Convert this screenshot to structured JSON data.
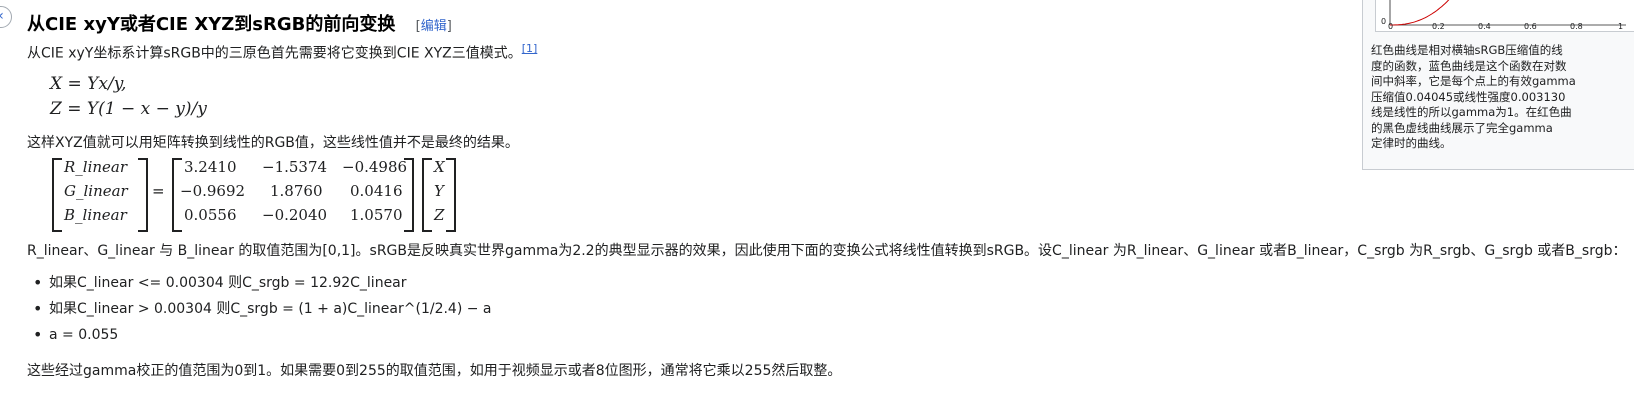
{
  "heading": {
    "title": "从CIE xyY或者CIE XYZ到sRGB的前向变换",
    "edit_open": "[",
    "edit_label": "编辑",
    "edit_close": "]"
  },
  "para1": {
    "text": "从CIE xyY坐标系计算sRGB中的三原色首先需要将它变换到CIE XYZ三值模式。",
    "ref": "[1]"
  },
  "eq1": "X = Yx/y,",
  "eq2": "Z = Y(1 − x − y)/y",
  "para2": "这样XYZ值就可以用矩阵转换到线性的RGB值，这些线性值并不是最终的结果。",
  "matrix": {
    "lhs": [
      "R_linear",
      "G_linear",
      "B_linear"
    ],
    "rows": [
      [
        "3.2410",
        "−1.5374",
        "−0.4986"
      ],
      [
        "−0.9692",
        "1.8760",
        "0.0416"
      ],
      [
        "0.0556",
        "−0.2040",
        "1.0570"
      ]
    ],
    "rhs": [
      "X",
      "Y",
      "Z"
    ],
    "equals": "="
  },
  "para3": "R_linear、G_linear 与 B_linear 的取值范围为[0,1]。sRGB是反映真实世界gamma为2.2的典型显示器的效果，因此使用下面的变换公式将线性值转换到sRGB。设C_linear 为R_linear、G_linear 或者B_linear，C_srgb 为R_srgb、G_srgb 或者B_srgb：",
  "bullets": [
    "如果C_linear <= 0.00304 则C_srgb = 12.92C_linear",
    "如果C_linear > 0.00304 则C_srgb = (1 + a)C_linear^(1/2.4) − a",
    "a = 0.055"
  ],
  "para4": "这些经过gamma校正的值范围为0到1。如果需要0到255的取值范围，如用于视频显示或者8位图形，通常将它乘以255然后取整。",
  "thumb": {
    "axis_ticks": [
      "0",
      "0.2",
      "0.4",
      "0.6",
      "0.8",
      "1"
    ],
    "y_tick": "0",
    "caption_lines": [
      "红色曲线是相对横轴sRGB压缩值的线",
      "度的函数，蓝色曲线是这个函数在对数",
      "间中斜率，它是每个点上的有效gamma",
      "压缩值0.04045或线性强度0.003130",
      "线是线性的所以gamma为1。在红色曲",
      "的黑色虚线曲线展示了完全gamma",
      "定律时的曲线。"
    ],
    "curve_color": "#cc0000"
  }
}
